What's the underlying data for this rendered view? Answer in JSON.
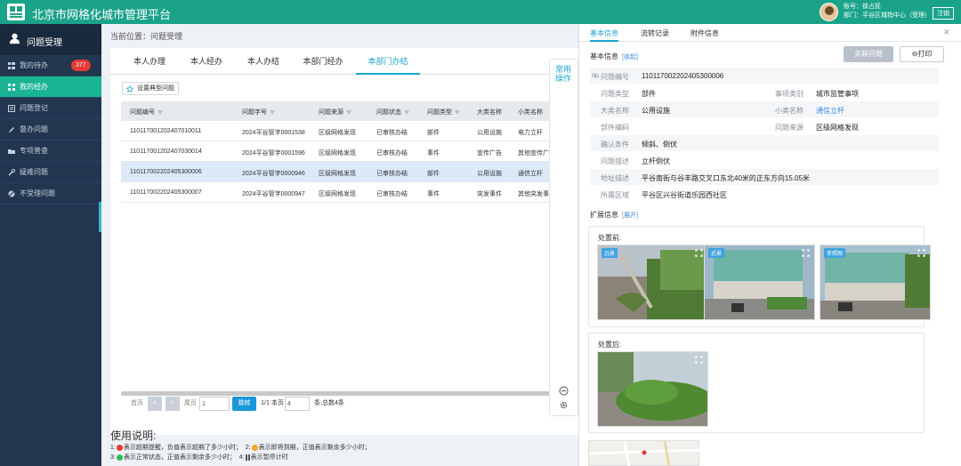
{
  "header": {
    "title": "北京市网格化城市管理平台",
    "user_line1": "账号：徐占民",
    "user_line2": "部门：平谷区城指中心（受理）",
    "logout_label": "注销"
  },
  "sidebar": {
    "title": "问题受理",
    "items": [
      {
        "label": "我的待办",
        "icon": "list-icon",
        "badge": "377"
      },
      {
        "label": "我的经办",
        "icon": "grid-icon"
      },
      {
        "label": "问题登记",
        "icon": "register-icon"
      },
      {
        "label": "督办问题",
        "icon": "pen-icon"
      },
      {
        "label": "专项普查",
        "icon": "folder-icon"
      },
      {
        "label": "疑难问题",
        "icon": "wrench-icon"
      },
      {
        "label": "不受理问题",
        "icon": "ban-icon"
      }
    ]
  },
  "main": {
    "breadcrumb": "当前位置：问题受理",
    "tabs": [
      "本人办理",
      "本人经办",
      "本人办结",
      "本部门经办",
      "本部门办结"
    ],
    "typical_button": "设置典型问题",
    "columns": [
      "问题编号",
      "问题字号",
      "问题来源",
      "问题状态",
      "问题类型",
      "大类名称",
      "小类名称"
    ],
    "rows": [
      [
        "110117001202407010011",
        "2024平谷管字0001538",
        "区级网格发现",
        "已审核办结",
        "部件",
        "公用设施",
        "电力立杆"
      ],
      [
        "110117001202407030014",
        "2024平谷管字0001596",
        "区级网格发现",
        "已审核办结",
        "事件",
        "宣传广告",
        "其他宣传广告"
      ],
      [
        "110117002202405300006",
        "2024平谷管字0000946",
        "区级网格发现",
        "已审核办结",
        "部件",
        "公用设施",
        "通信立杆"
      ],
      [
        "110117002202405300007",
        "2024平谷管字0000947",
        "区级网格发现",
        "已审核办结",
        "事件",
        "突发事件",
        "其他突发事件"
      ]
    ],
    "pager": {
      "first": "首页",
      "prev": "<",
      "next": ">",
      "last": "尾页",
      "page_value": "1",
      "jump_label": "跳转",
      "page_info": "1/1 本页",
      "page_size": "4",
      "total_info": "条,总数4条"
    },
    "usage": {
      "title": "使用说明:",
      "line1a": "1:",
      "line1b": "表示超期提醒，负值表示超期了多少小时；",
      "line1c": "2:",
      "line1d": "表示即将到期，正值表示剩余多少小时；",
      "line2a": "3:",
      "line2b": "表示正常状态，正值表示剩余多少小时；",
      "line2c": "4:",
      "line2d": "表示暂停计时"
    }
  },
  "quick_panel": {
    "label": "常用操作"
  },
  "detail": {
    "tabs": [
      "基本信息",
      "流转记录",
      "附件信息"
    ],
    "basic_title": "基本信息",
    "basic_toggle": "[收起]",
    "relate_button": "关联问题",
    "print_button": "打印",
    "fields": {
      "id_label": "问题编号",
      "id_value": "110117002202405300006",
      "type_label": "问题类型",
      "type_value": "部件",
      "category_label": "事项类别",
      "category_value": "城市监管事项",
      "major_label": "大类名称",
      "major_value": "公用设施",
      "minor_label": "小类名称",
      "minor_value": "通信立杆",
      "code_label": "部件编码",
      "code_value": "",
      "source_label": "问题来源",
      "source_value": "区级网格发现",
      "condition_label": "确认条件",
      "condition_value": "倾斜、倒伏",
      "desc_label": "问题描述",
      "desc_value": "立杆倒伏",
      "address_label": "地址描述",
      "address_value": "平谷南街与谷丰路交叉口东北40米的正东方向15.05米",
      "area_label": "所属区域",
      "area_value": "平谷区兴谷街道乐园西社区"
    },
    "ext_title": "扩展信息",
    "ext_toggle": "[展开]",
    "before_caption": "处置前:",
    "after_caption": "处置后:",
    "before_tags": [
      "远景",
      "近景",
      "参照图"
    ]
  },
  "colors": {
    "brand": "#1ba38a",
    "sidebar": "#22364f",
    "active": "#1ab394",
    "accent": "#1ba6cf",
    "badge": "#e53935"
  }
}
